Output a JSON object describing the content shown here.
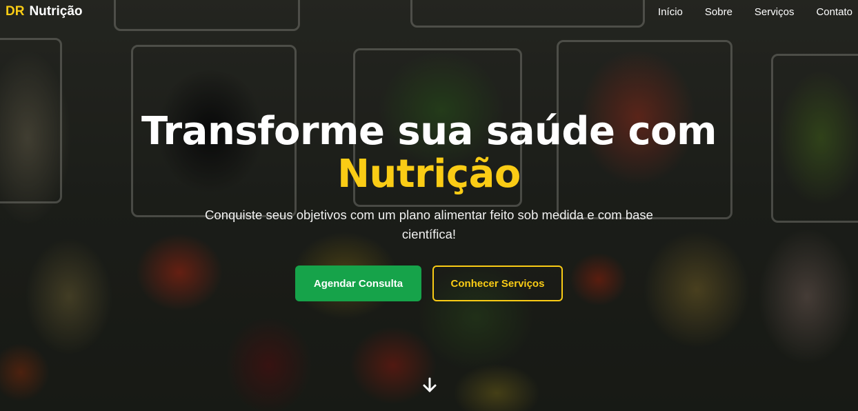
{
  "navbar": {
    "logo_mark": "DR",
    "logo_text": "Nutrição",
    "links": [
      {
        "label": "Início"
      },
      {
        "label": "Sobre"
      },
      {
        "label": "Serviços"
      },
      {
        "label": "Contato"
      }
    ]
  },
  "hero": {
    "title_line1": "Transforme sua saúde com",
    "title_accent": "Nutrição",
    "subtitle": "Conquiste seus objetivos com um plano alimentar feito sob medida e com base científica!",
    "primary_button": "Agendar Consulta",
    "secondary_button": "Conhecer Serviços",
    "scroll_icon": "arrow-down-icon"
  },
  "colors": {
    "accent": "#facc15",
    "primary": "#16a34a",
    "text": "#ffffff"
  }
}
